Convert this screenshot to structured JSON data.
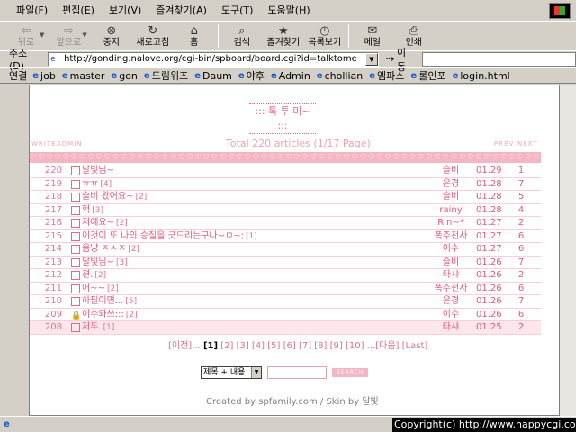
{
  "menubar": {
    "items": [
      "파일(F)",
      "편집(E)",
      "보기(V)",
      "즐겨찾기(A)",
      "도구(T)",
      "도움말(H)"
    ]
  },
  "toolbar": {
    "back": "뒤로",
    "forward": "앞으로",
    "stop": "중지",
    "refresh": "새로고침",
    "home": "홈",
    "search": "검색",
    "favorites": "즐겨찾기",
    "history": "목록보기",
    "mail": "메일",
    "print": "인쇄"
  },
  "address": {
    "label": "주소(D)",
    "url": "http://gonding.nalove.org/cgi-bin/spboard/board.cgi?id=talktome",
    "go": "이동"
  },
  "links": {
    "label": "연결",
    "items": [
      "job",
      "master",
      "gon",
      "드림위즈",
      "Daum",
      "야후",
      "Admin",
      "chollian",
      "엠파스",
      "롤인포",
      "login.html"
    ]
  },
  "board": {
    "title": "::: 톡 투 미~ :::",
    "write": "WRITE",
    "admin": "ADMIN",
    "total": "Total 220 articles (1/17 Page)",
    "prev": "PREV",
    "next": "NEXT",
    "hearts": "♡♡♡♡♡♡♡♡♡♡♡♡♡♡♡♡♡♡♡♡♡♡♡♡♡♡♡♡♡♡♡♡♡♡♡♡♡♡♡♡♡♡♡♡♡♡♡♡♡♡♡♡♡♡♡♡♡♡♡♡♡♡♡♡♡♡♡",
    "posts": [
      {
        "no": "220",
        "subject": "달빛님~",
        "comments": "",
        "name": "슬비",
        "date": "01.29",
        "hits": "1"
      },
      {
        "no": "219",
        "subject": "ㅠㅠ",
        "comments": "[4]",
        "name": "은경",
        "date": "01.28",
        "hits": "7"
      },
      {
        "no": "218",
        "subject": "슬비 왔어요~",
        "comments": "[2]",
        "name": "슬비",
        "date": "01.28",
        "hits": "5"
      },
      {
        "no": "217",
        "subject": "헉",
        "comments": "[3]",
        "name": "rainy",
        "date": "01.28",
        "hits": "4"
      },
      {
        "no": "216",
        "subject": "저예요~",
        "comments": "[2]",
        "name": "Rin~*",
        "date": "01.27",
        "hits": "2"
      },
      {
        "no": "215",
        "subject": "이것이 또 나의 승질을 긋드리는구나~ㅁ~;",
        "comments": "[1]",
        "name": "폭주천사",
        "date": "01.27",
        "hits": "6"
      },
      {
        "no": "214",
        "subject": "음냥 ㅈㅅㅈ",
        "comments": "[2]",
        "name": "이수",
        "date": "01.27",
        "hits": "6"
      },
      {
        "no": "213",
        "subject": "달빛님~",
        "comments": "[3]",
        "name": "슬비",
        "date": "01.26",
        "hits": "7"
      },
      {
        "no": "212",
        "subject": "젼.",
        "comments": "[2]",
        "name": "타샤",
        "date": "01.26",
        "hits": "2"
      },
      {
        "no": "211",
        "subject": "어~~",
        "comments": "[2]",
        "name": "폭주천사",
        "date": "01.26",
        "hits": "6"
      },
      {
        "no": "210",
        "subject": "하필이면...",
        "comments": "[5]",
        "name": "은경",
        "date": "01.26",
        "hits": "7"
      },
      {
        "no": "209",
        "subject": "이수와쓰:::",
        "comments": "[2]",
        "name": "이수",
        "date": "01.26",
        "hits": "6",
        "locked": true
      },
      {
        "no": "208",
        "subject": "저두.",
        "comments": "[1]",
        "name": "타샤",
        "date": "01.25",
        "hits": "2"
      }
    ],
    "pager": {
      "prev": "[이전]...",
      "current": "[1]",
      "pages": "[2] [3] [4] [5] [6] [7] [8] [9] [10]",
      "next": "...[다음]",
      "last": "[Last]"
    },
    "search_select": "제목 + 내용",
    "search_button": "SEARCH",
    "credit": "Created by spfamily.com / Skin by 달빛"
  },
  "status": {
    "text": "Copyright(c) http://www.happycgi.com"
  }
}
